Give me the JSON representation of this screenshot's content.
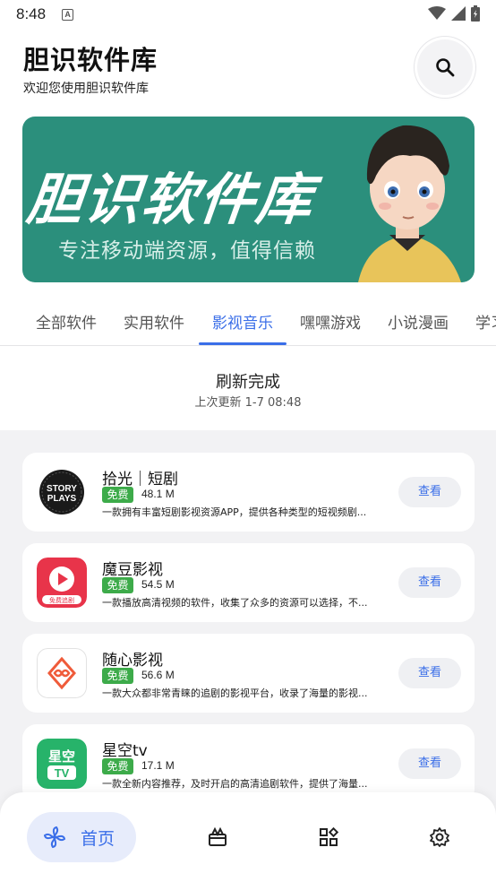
{
  "status_bar": {
    "time": "8:48",
    "notification_glyph": "A"
  },
  "header": {
    "title": "胆识软件库",
    "subtitle": "欢迎您使用胆识软件库",
    "search_icon": "search-icon"
  },
  "banner": {
    "title": "胆识软件库",
    "subtitle": "专注移动端资源，值得信赖"
  },
  "tabs": [
    {
      "label": "全部软件",
      "active": false
    },
    {
      "label": "实用软件",
      "active": false
    },
    {
      "label": "影视音乐",
      "active": true
    },
    {
      "label": "嘿嘿游戏",
      "active": false
    },
    {
      "label": "小说漫画",
      "active": false
    },
    {
      "label": "学习",
      "active": false
    }
  ],
  "refresh": {
    "title": "刷新完成",
    "time": "上次更新 1-7 08:48"
  },
  "apps": [
    {
      "name": "拾光｜短剧",
      "badge": "免费",
      "size": "48.1 M",
      "desc": "一款拥有丰富短剧影视资源APP，提供各种类型的短视频剧...",
      "button": "查看",
      "icon_text": "STORY PLAYS"
    },
    {
      "name": "魔豆影视",
      "badge": "免费",
      "size": "54.5 M",
      "desc": "一款播放高清视频的软件，收集了众多的资源可以选择，不...",
      "button": "查看",
      "icon_text": "免费追剧"
    },
    {
      "name": "随心影视",
      "badge": "免费",
      "size": "56.6 M",
      "desc": "一款大众都非常青睐的追剧的影视平台，收录了海量的影视...",
      "button": "查看"
    },
    {
      "name": "星空tv",
      "badge": "免费",
      "size": "17.1 M",
      "desc": "一款全新内容推荐，及时开启的高清追剧软件，提供了海量...",
      "button": "查看",
      "icon_text_top": "星空",
      "icon_text_bottom": "TV"
    }
  ],
  "bottom_nav": {
    "home_label": "首页",
    "items": [
      "home-icon",
      "gift-icon",
      "apps-grid-icon",
      "settings-icon"
    ]
  },
  "colors": {
    "accent": "#3a6ee8",
    "banner_bg": "#2b8f7c",
    "free_badge": "#3dab4a"
  }
}
